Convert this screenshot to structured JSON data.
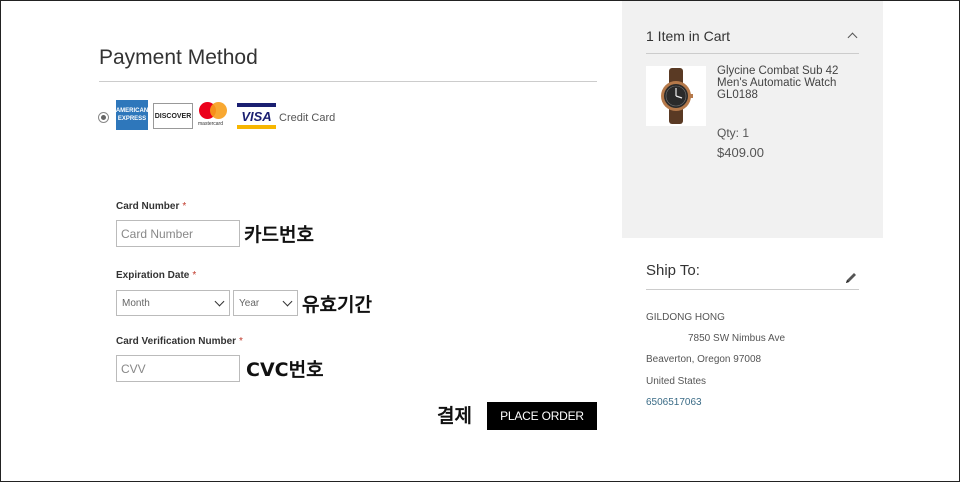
{
  "payment": {
    "title": "Payment Method",
    "card_brands": {
      "amex_line1": "AMERICAN",
      "amex_line2": "EXPRESS",
      "discover": "DISCOVER",
      "mastercard": "mastercard",
      "visa": "VISA"
    },
    "credit_card_label": "Credit Card",
    "card_number": {
      "label": "Card Number",
      "required_mark": "*",
      "placeholder": "Card Number",
      "annotation": "카드번호"
    },
    "expiration": {
      "label": "Expiration Date",
      "required_mark": "*",
      "month_value": "Month",
      "year_value": "Year",
      "annotation": "유효기간"
    },
    "cvv": {
      "label": "Card Verification Number",
      "required_mark": "*",
      "placeholder": "CVV",
      "annotation": "CVC번호"
    },
    "place_order": {
      "annotation": "결제",
      "label": "PLACE ORDER"
    }
  },
  "cart": {
    "title": "1 Item in Cart",
    "item": {
      "name": "Glycine Combat Sub 42 Men's Automatic Watch GL0188",
      "qty": "Qty: 1",
      "price": "$409.00"
    }
  },
  "ship_to": {
    "title": "Ship To:",
    "name": "GILDONG HONG",
    "street": "7850 SW Nimbus Ave",
    "city": "Beaverton, Oregon 97008",
    "country": "United States",
    "phone": "6506517063"
  },
  "colors": {
    "place_order_bg": "#000000",
    "sidebar_bg": "#f1f1f1",
    "required": "#c0392b",
    "phone_link": "#3a6b86"
  },
  "icons": {
    "cart_toggle": "chevron-up-icon",
    "edit_shipping": "pencil-icon"
  }
}
